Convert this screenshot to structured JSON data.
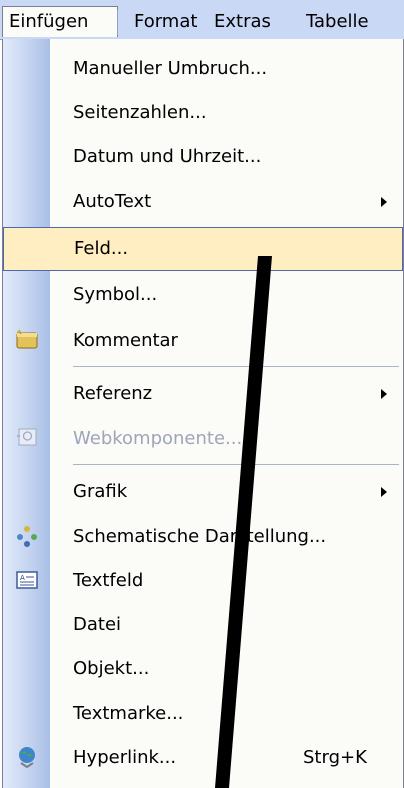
{
  "menubar": {
    "items": [
      {
        "label": "Einfügen"
      },
      {
        "label": "Format"
      },
      {
        "label": "Extras"
      },
      {
        "label": "Tabelle"
      }
    ]
  },
  "menu": {
    "items": [
      {
        "label": "Manueller Umbruch..."
      },
      {
        "label": "Seitenzahlen..."
      },
      {
        "label": "Datum und Uhrzeit..."
      },
      {
        "label": "AutoText"
      },
      {
        "label": "Feld..."
      },
      {
        "label": "Symbol..."
      },
      {
        "label": "Kommentar"
      },
      {
        "label": "Referenz"
      },
      {
        "label": "Webkomponente..."
      },
      {
        "label": "Grafik"
      },
      {
        "label": "Schematische Darstellung..."
      },
      {
        "label": "Textfeld"
      },
      {
        "label": "Datei"
      },
      {
        "label": "Objekt..."
      },
      {
        "label": "Textmarke..."
      },
      {
        "label": "Hyperlink...",
        "shortcut": "Strg+K"
      }
    ]
  },
  "colors": {
    "highlight": "#ffeec2",
    "gutter": "#c4d4f0",
    "menubar": "#c9d8f4",
    "disabled_text": "#9da6b8"
  },
  "icons": [
    "comment-icon",
    "web-component-icon",
    "diagram-icon",
    "textbox-icon",
    "hyperlink-globe-icon",
    "submenu-arrow-icon"
  ]
}
